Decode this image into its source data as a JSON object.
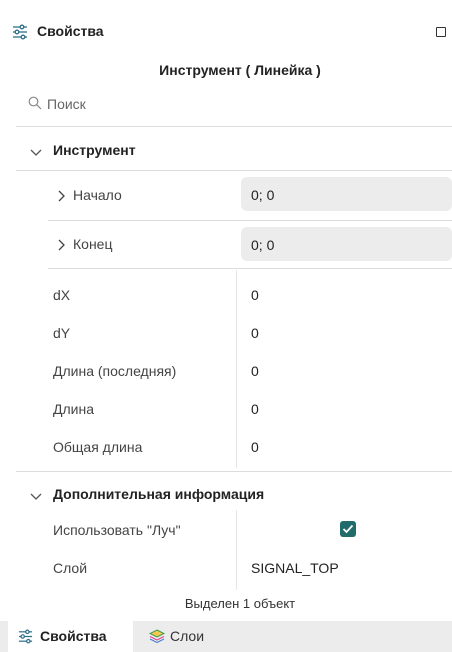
{
  "panel": {
    "title": "Свойства",
    "subtitle": "Инструмент ( Линейка )"
  },
  "search": {
    "placeholder": "Поиск"
  },
  "sections": {
    "instrument": {
      "title": "Инструмент",
      "rows": [
        {
          "label": "Начало",
          "value": "0; 0"
        },
        {
          "label": "Конец",
          "value": "0; 0"
        },
        {
          "label": "dX",
          "value": "0"
        },
        {
          "label": "dY",
          "value": "0"
        },
        {
          "label": "Длина (последняя)",
          "value": "0"
        },
        {
          "label": "Длина",
          "value": "0"
        },
        {
          "label": "Общая длина",
          "value": "0"
        }
      ]
    },
    "extra": {
      "title": "Дополнительная информация",
      "rows": [
        {
          "label": "Использовать \"Луч\"",
          "checked": true
        },
        {
          "label": "Слой",
          "value": "SIGNAL_TOP"
        }
      ]
    }
  },
  "status": "Выделен 1 объект",
  "tabs": [
    {
      "label": "Свойства",
      "icon": "properties-icon",
      "active": true
    },
    {
      "label": "Слои",
      "icon": "layers-icon",
      "active": false
    }
  ],
  "colors": {
    "accent": "#226b6b",
    "field_bg": "#ececec",
    "tabbar_bg": "#ececec"
  }
}
